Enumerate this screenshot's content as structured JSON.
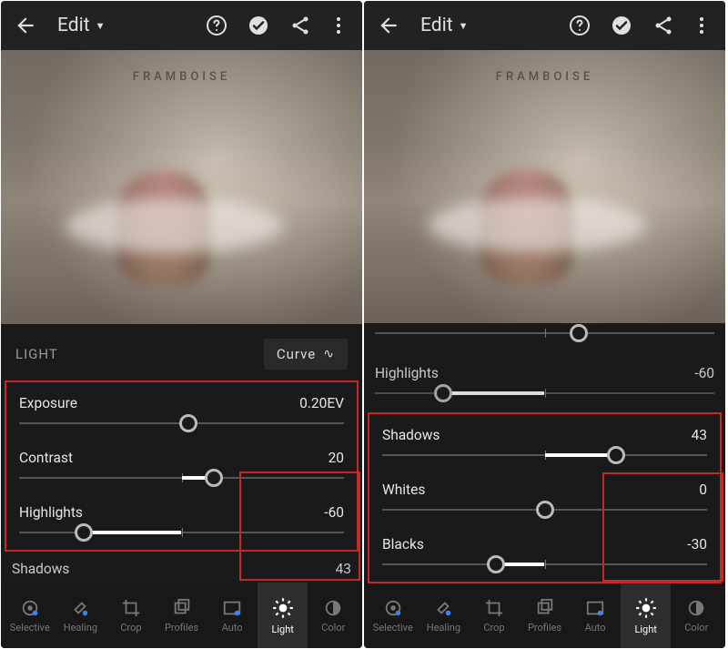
{
  "panels": [
    {
      "header": {
        "title": "Edit"
      },
      "photo_sign": "FRAMBOISE",
      "light_section": {
        "label": "LIGHT",
        "curve_label": "Curve"
      },
      "sliders": [
        {
          "label": "Exposure",
          "value": "0.20EV",
          "thumb_pct": 52,
          "fill_from": 50,
          "fill_to": 52
        },
        {
          "label": "Contrast",
          "value": "20",
          "thumb_pct": 60,
          "fill_from": 50,
          "fill_to": 60
        },
        {
          "label": "Highlights",
          "value": "-60",
          "thumb_pct": 20,
          "fill_from": 20,
          "fill_to": 50
        }
      ],
      "below_hint": {
        "label": "Shadows",
        "value": "43"
      },
      "nav": [
        {
          "label": "Selective"
        },
        {
          "label": "Healing"
        },
        {
          "label": "Crop"
        },
        {
          "label": "Profiles"
        },
        {
          "label": "Auto"
        },
        {
          "label": "Light",
          "active": true
        },
        {
          "label": "Color"
        }
      ]
    },
    {
      "header": {
        "title": "Edit"
      },
      "photo_sign": "FRAMBOISE",
      "top_peek": {
        "label": "Highlights",
        "value": "-60",
        "thumb_pct": 20,
        "fill_from": 20,
        "fill_to": 50
      },
      "highlight_slider": {
        "label": "Highlights",
        "value": "-60"
      },
      "sliders": [
        {
          "label": "Shadows",
          "value": "43",
          "thumb_pct": 72,
          "fill_from": 50,
          "fill_to": 72
        },
        {
          "label": "Whites",
          "value": "0",
          "thumb_pct": 50,
          "fill_from": 50,
          "fill_to": 50
        },
        {
          "label": "Blacks",
          "value": "-30",
          "thumb_pct": 35,
          "fill_from": 35,
          "fill_to": 50
        }
      ],
      "nav": [
        {
          "label": "Selective"
        },
        {
          "label": "Healing"
        },
        {
          "label": "Crop"
        },
        {
          "label": "Profiles"
        },
        {
          "label": "Auto"
        },
        {
          "label": "Light",
          "active": true
        },
        {
          "label": "Color"
        }
      ]
    }
  ]
}
